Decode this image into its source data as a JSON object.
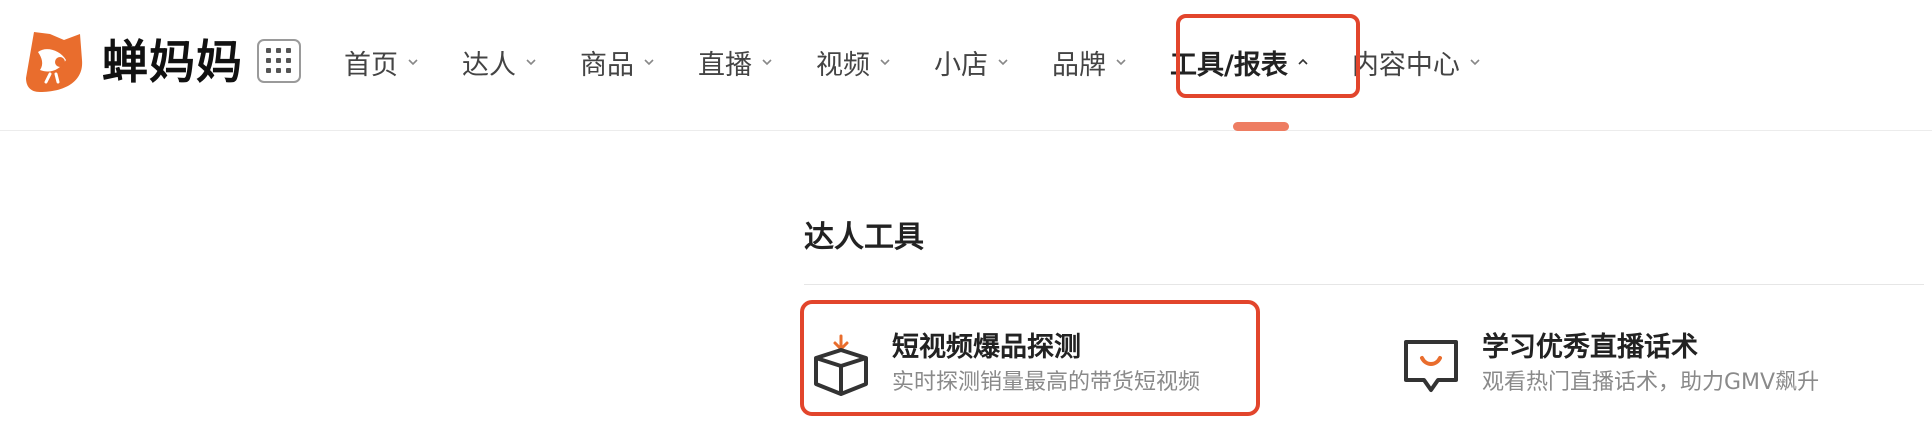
{
  "brand": {
    "name": "蝉妈妈",
    "accent": "#e96d2d",
    "highlight": "#e2452c"
  },
  "nav": {
    "items": [
      {
        "label": "首页",
        "icon": "chevron-down-icon"
      },
      {
        "label": "达人",
        "icon": "chevron-down-icon"
      },
      {
        "label": "商品",
        "icon": "chevron-down-icon"
      },
      {
        "label": "直播",
        "icon": "chevron-down-icon"
      },
      {
        "label": "视频",
        "icon": "chevron-down-icon"
      },
      {
        "label": "小店",
        "icon": "chevron-down-icon"
      },
      {
        "label": "品牌",
        "icon": "chevron-down-icon"
      },
      {
        "label": "工具/报表",
        "icon": "chevron-up-icon"
      },
      {
        "label": "内容中心",
        "icon": "chevron-down-icon"
      }
    ],
    "active": "工具/报表"
  },
  "dropdown": {
    "section_title": "达人工具",
    "tools": [
      {
        "title": "短视频爆品探测",
        "desc": "实时探测销量最高的带货短视频",
        "icon": "box-download-icon"
      },
      {
        "title": "学习优秀直播话术",
        "desc": "观看热门直播话术，助力GMV飙升",
        "icon": "chat-smile-icon"
      }
    ]
  }
}
